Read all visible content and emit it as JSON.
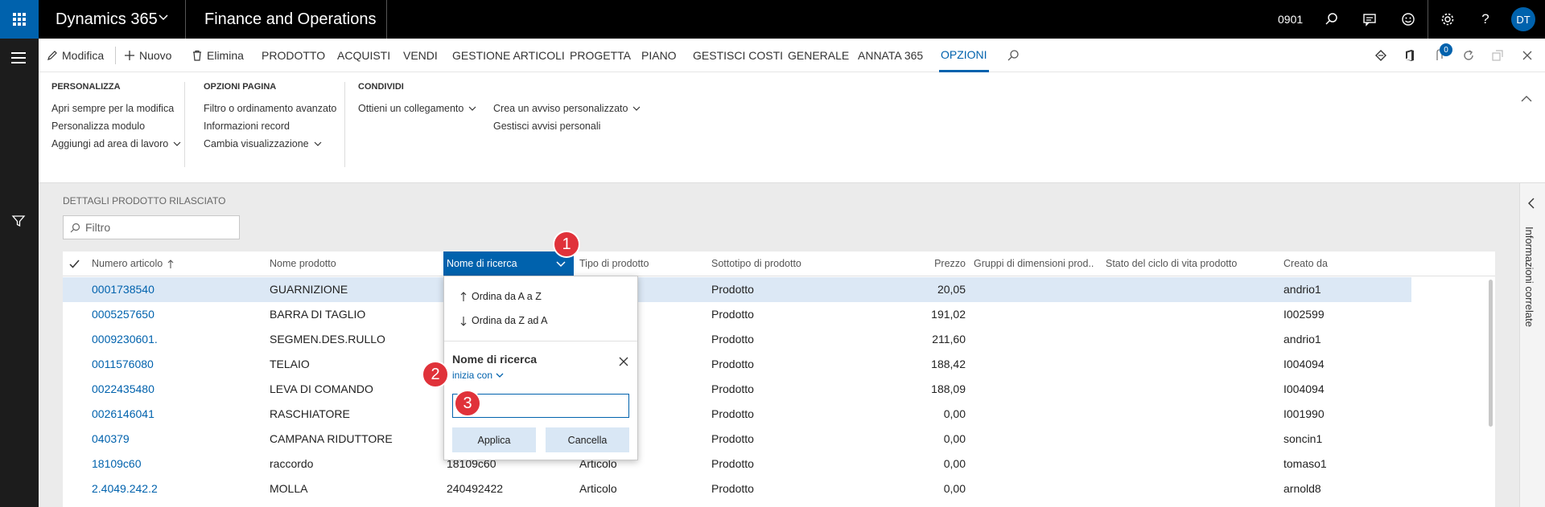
{
  "topbar": {
    "app_name": "Dynamics 365",
    "module_name": "Finance and Operations",
    "company": "0901",
    "user_initials": "DT"
  },
  "actionbar": {
    "items": [
      {
        "label": "Modifica",
        "icon": "pencil-icon"
      },
      {
        "label": "Nuovo",
        "icon": "plus-icon"
      },
      {
        "label": "Elimina",
        "icon": "trash-icon"
      },
      {
        "label": "PRODOTTO"
      },
      {
        "label": "ACQUISTI"
      },
      {
        "label": "VENDI"
      },
      {
        "label": "GESTIONE ARTICOLI"
      },
      {
        "label": "PROGETTA"
      },
      {
        "label": "PIANO"
      },
      {
        "label": "GESTISCI COSTI"
      },
      {
        "label": "GENERALE"
      },
      {
        "label": "ANNATA 365"
      },
      {
        "label": "OPZIONI"
      }
    ],
    "notification_count": "0"
  },
  "ribbon": {
    "groups": [
      {
        "title": "PERSONALIZZA",
        "items": [
          "Apri sempre per la modifica",
          "Personalizza modulo",
          "Aggiungi ad area di lavoro"
        ]
      },
      {
        "title": "OPZIONI PAGINA",
        "items": [
          "Filtro o ordinamento avanzato",
          "Informazioni record",
          "Cambia visualizzazione"
        ]
      },
      {
        "title": "CONDIVIDI",
        "items": [
          "Ottieni un collegamento",
          "Crea un avviso personalizzato",
          "Gestisci avvisi personali"
        ]
      }
    ]
  },
  "page": {
    "section_title": "DETTAGLI PRODOTTO RILASCIATO",
    "filter_placeholder": "Filtro"
  },
  "grid": {
    "columns": [
      "Numero articolo",
      "Nome prodotto",
      "Nome di ricerca",
      "Tipo di prodotto",
      "Sottotipo di prodotto",
      "Prezzo",
      "Gruppi di dimensioni prod...",
      "Stato del ciclo di vita prodotto",
      "Creato da"
    ],
    "rows": [
      {
        "item": "0001738540",
        "name": "GUARNIZIONE",
        "search": "",
        "type": "",
        "subtype": "Prodotto",
        "price": "20,05",
        "created": "andrio1"
      },
      {
        "item": "0005257650",
        "name": "BARRA DI TAGLIO",
        "search": "",
        "type": "",
        "subtype": "Prodotto",
        "price": "191,02",
        "created": "I002599"
      },
      {
        "item": "0009230601.",
        "name": "SEGMEN.DES.RULLO",
        "search": "",
        "type": "",
        "subtype": "Prodotto",
        "price": "211,60",
        "created": "andrio1"
      },
      {
        "item": "0011576080",
        "name": "TELAIO",
        "search": "",
        "type": "",
        "subtype": "Prodotto",
        "price": "188,42",
        "created": "I004094"
      },
      {
        "item": "0022435480",
        "name": "LEVA DI COMANDO",
        "search": "",
        "type": "",
        "subtype": "Prodotto",
        "price": "188,09",
        "created": "I004094"
      },
      {
        "item": "0026146041",
        "name": "RASCHIATORE",
        "search": "",
        "type": "",
        "subtype": "Prodotto",
        "price": "0,00",
        "created": "I001990"
      },
      {
        "item": "040379",
        "name": "CAMPANA RIDUTTORE",
        "search": "",
        "type": "",
        "subtype": "Prodotto",
        "price": "0,00",
        "created": "soncin1"
      },
      {
        "item": "18109c60",
        "name": "raccordo",
        "search": "18109c60",
        "type": "Articolo",
        "subtype": "Prodotto",
        "price": "0,00",
        "created": "tomaso1"
      },
      {
        "item": "2.4049.242.2",
        "name": "MOLLA",
        "search": "240492422",
        "type": "Articolo",
        "subtype": "Prodotto",
        "price": "0,00",
        "created": "arnold8"
      }
    ]
  },
  "dropdown": {
    "sort_asc": "Ordina da A a Z",
    "sort_desc": "Ordina da Z ad A",
    "title": "Nome di ricerca",
    "operator": "inizia con",
    "input_value": "",
    "apply": "Applica",
    "cancel": "Cancella"
  },
  "right_pane": {
    "label": "Informazioni correlate"
  },
  "callouts": [
    "1",
    "2",
    "3"
  ],
  "colors": {
    "accent": "#0062ad",
    "callout": "#e0323a",
    "selected_row": "#dce8f5"
  }
}
